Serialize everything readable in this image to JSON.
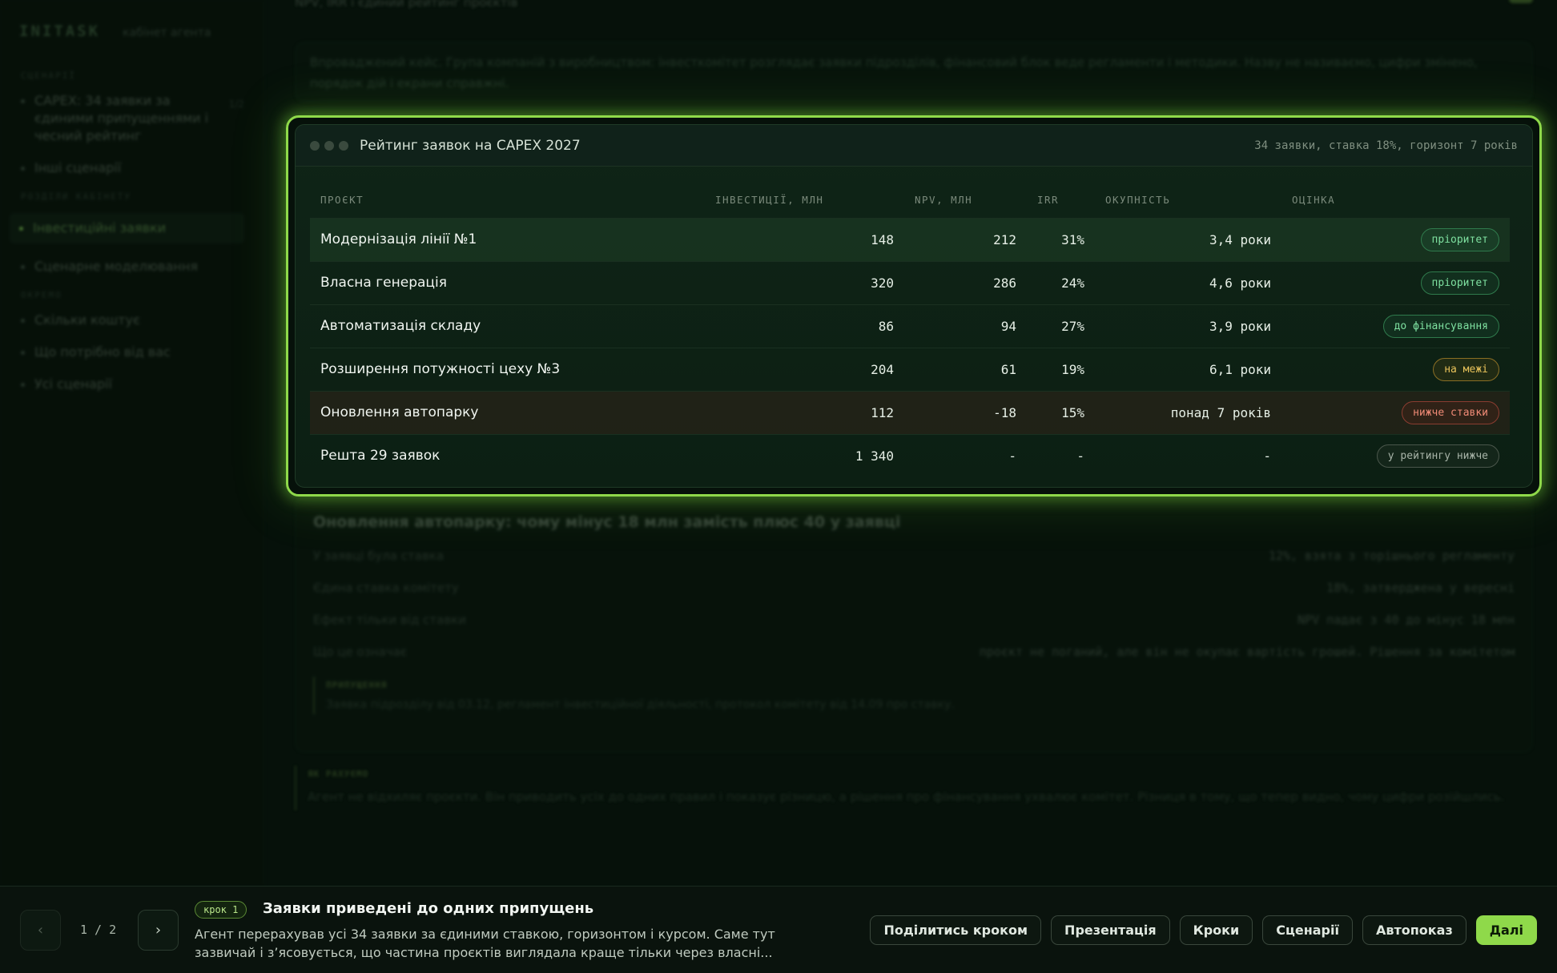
{
  "sidebar": {
    "brand": "INITASK",
    "brand_sub": "кабінет агента",
    "section1": "СЦЕНАРІЇ",
    "scenario_active": "CAPEX: 34 заявки за єдиними припущеннями і чесний рейтинг",
    "scenario_count": "1/2",
    "scenario_other": "Інші сценарії",
    "section2": "РОЗДІЛИ КАБІНЕТУ",
    "nav_active": "Інвестиційні заявки",
    "nav_other": "Сценарне моделювання",
    "section3": "ОКРЕМО",
    "extra": [
      "Скільки коштує",
      "Що потрібно від вас",
      "Усі сценарії"
    ]
  },
  "main": {
    "top_title": "NPV, IRR і єдиний рейтинг проєктів",
    "intro": "Впроваджений кейс. Група компаній з виробництвом: інвесткомітет розглядає заявки підрозділів, фінансовий блок веде регламенти і методики. Назву не називаємо, цифри змінено, порядок дій і екрани справжні."
  },
  "table_card": {
    "title": "Рейтинг заявок на CAPEX 2027",
    "meta": "34 заявки, ставка 18%, горизонт 7 років",
    "headers": [
      "ПРОЄКТ",
      "ІНВЕСТИЦІЇ, МЛН",
      "NPV, МЛН",
      "IRR",
      "ОКУПНІСТЬ",
      "ОЦІНКА"
    ],
    "rows": [
      {
        "name": "Модернізація лінії №1",
        "invest": "148",
        "npv": "212",
        "irr": "31%",
        "payback": "3,4 роки",
        "badge": "пріоритет"
      },
      {
        "name": "Власна генерація",
        "invest": "320",
        "npv": "286",
        "irr": "24%",
        "payback": "4,6 роки",
        "badge": "пріоритет"
      },
      {
        "name": "Автоматизація складу",
        "invest": "86",
        "npv": "94",
        "irr": "27%",
        "payback": "3,9 роки",
        "badge": "до фінансування"
      },
      {
        "name": "Розширення потужності цеху №3",
        "invest": "204",
        "npv": "61",
        "irr": "19%",
        "payback": "6,1 роки",
        "badge": "на межі"
      },
      {
        "name": "Оновлення автопарку",
        "invest": "112",
        "npv": "-18",
        "irr": "15%",
        "payback": "понад 7 років",
        "badge": "нижче ставки"
      },
      {
        "name": "Решта 29 заявок",
        "invest": "1 340",
        "npv": "-",
        "irr": "-",
        "payback": "-",
        "badge": "у рейтингу нижче"
      }
    ]
  },
  "detail": {
    "title": "Оновлення автопарку: чому мінус 18 млн замість плюс 40 у заявці",
    "rows": [
      {
        "k": "У заявці була ставка",
        "v": "12%, взята з торішнього регламенту"
      },
      {
        "k": "Єдина ставка комітету",
        "v": "18%, затверджена у вересні"
      },
      {
        "k": "Ефект тільки від ставки",
        "v": "NPV падає з 40 до мінус 18 млн"
      },
      {
        "k": "Що це означає",
        "v": "проєкт не поганий, але він не окупає вартість грошей. Рішення за комітетом"
      }
    ],
    "assume_title": "ПРИПУЩЕННЯ",
    "assume_body": "Заявка підрозділу від 03.12, регламент інвестиційної діяльності, протокол комітету від 14.09 про ставку."
  },
  "note": {
    "title": "ЯК РАХУЄМО",
    "body": "Агент не відхиляє проєкти. Він приводить усіх до одних правил і показує різницю, а рішення про фінансування ухвалює комітет. Різниця в тому, що тепер видно, чому цифри розійшлись."
  },
  "bottom": {
    "pager": "1 / 2",
    "step_pill": "крок 1",
    "step_title": "Заявки приведені до одних припущень",
    "step_desc": "Агент перерахував усі 34 заявки за єдиними ставкою, горизонтом і курсом. Саме тут зазвичай і з’ясовується, що частина проєктів виглядала краще тільки через власні...",
    "buttons": [
      "Поділитись кроком",
      "Презентація",
      "Кроки",
      "Сценарії",
      "Автопоказ",
      "Далі"
    ]
  },
  "icons": {
    "prev": "chevron-left-icon",
    "next": "chevron-right-icon"
  },
  "colors": {
    "accent": "#8fd94a",
    "priority": "#7ee0a0",
    "edge": "#e8c25a",
    "below": "#f08a76"
  }
}
